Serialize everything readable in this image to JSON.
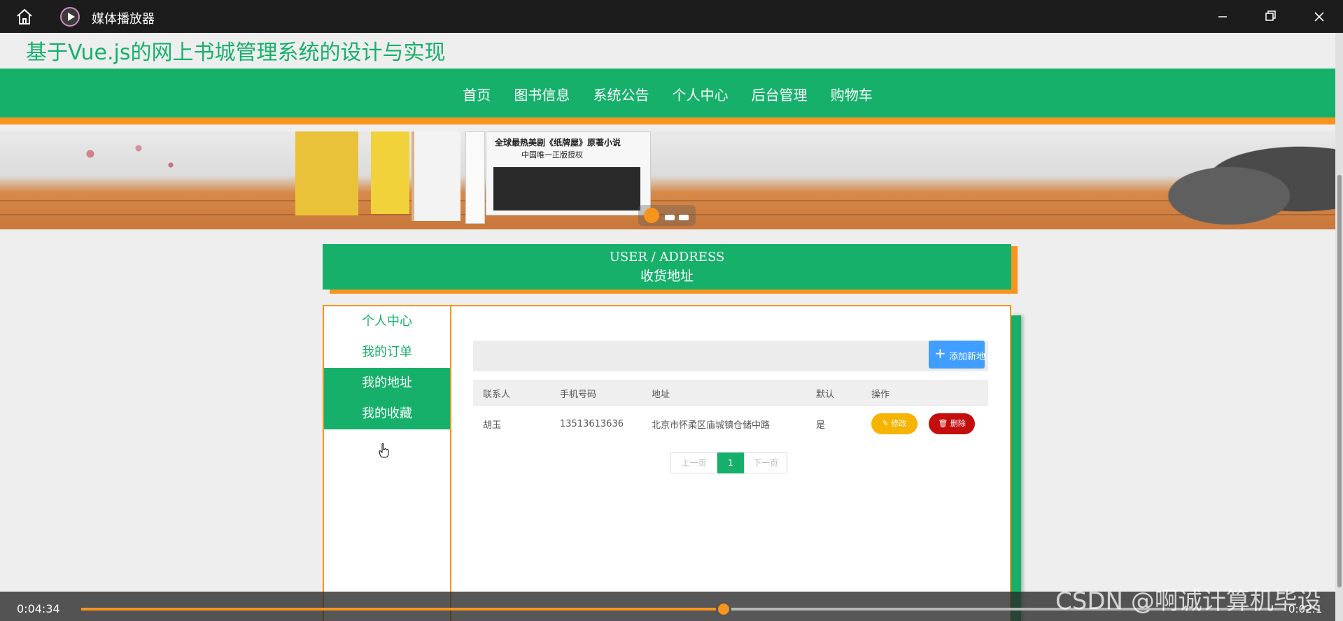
{
  "player": {
    "title": "媒体播放器",
    "time_elapsed": "0:04:34",
    "time_remaining": "0:02:1",
    "progress_fraction": 0.534,
    "watermark": "CSDN @啊诚计算机毕设"
  },
  "site": {
    "title": "基于Vue.js的网上书城管理系统的设计与实现",
    "nav": [
      "首页",
      "图书信息",
      "系统公告",
      "个人中心",
      "后台管理",
      "购物车"
    ],
    "banner": {
      "headline": "全球最热美剧《纸牌屋》原著小说",
      "subhead": "中国唯一正版授权"
    }
  },
  "section": {
    "title_en": "USER / ADDRESS",
    "title_cn": "收货地址"
  },
  "sidebar": {
    "items": [
      {
        "label": "个人中心"
      },
      {
        "label": "我的订单"
      },
      {
        "label": "我的地址"
      },
      {
        "label": "我的收藏"
      }
    ]
  },
  "address": {
    "add_button": "添加新地址",
    "columns": [
      "联系人",
      "手机号码",
      "地址",
      "默认",
      "操作"
    ],
    "rows": [
      {
        "contact": "胡玉",
        "phone": "13513613636",
        "address": "北京市怀柔区庙城镇仓储中路",
        "default": "是"
      }
    ],
    "edit_label": "修改",
    "delete_label": "删除"
  },
  "pager": {
    "prev": "上一页",
    "current": "1",
    "next": "下一页"
  },
  "colors": {
    "brand_green": "#16b06b",
    "accent_orange": "#f7941d",
    "add_blue": "#409eff",
    "edit_yellow": "#f6b400",
    "delete_red": "#c40d0d"
  }
}
